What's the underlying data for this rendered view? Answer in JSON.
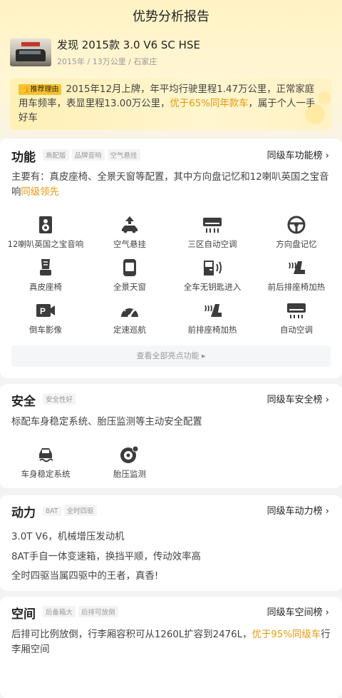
{
  "page": {
    "title": "优势分析报告"
  },
  "car": {
    "name": "发现 2015款 3.0 V6 SC HSE",
    "meta": "2015年 / 13万公里 / 石家庄"
  },
  "reason": {
    "tag": "推荐理由",
    "text_1": "2015年12月上牌，年平均行驶里程1.47万公里，正常家庭用车频率，表显里程13.00万公里，",
    "highlight": "优于65%同年款车",
    "text_2": "，属于个人一手好车"
  },
  "function": {
    "title": "功能",
    "chips": [
      "高配版",
      "品牌音响",
      "空气悬挂"
    ],
    "rank_link": "同级车功能榜 ›",
    "desc": "主要有：真皮座椅、全景天窗等配置，其中方向盘记忆和12喇叭英国之宝音响",
    "desc_highlight": "同级领先",
    "features": [
      {
        "label": "12喇叭英国之宝音响",
        "icon": "speaker-icon"
      },
      {
        "label": "空气悬挂",
        "icon": "air-suspension-icon"
      },
      {
        "label": "三区自动空调",
        "icon": "ac-unit-icon"
      },
      {
        "label": "方向盘记忆",
        "icon": "steering-wheel-icon"
      },
      {
        "label": "真皮座椅",
        "icon": "leather-seat-icon"
      },
      {
        "label": "全景天窗",
        "icon": "sunroof-icon"
      },
      {
        "label": "全车无钥匙进入",
        "icon": "keyless-door-icon"
      },
      {
        "label": "前后排座椅加热",
        "icon": "seat-heat-icon"
      },
      {
        "label": "倒车影像",
        "icon": "rear-camera-icon"
      },
      {
        "label": "定速巡航",
        "icon": "cruise-control-icon"
      },
      {
        "label": "前排座椅加热",
        "icon": "front-seat-heat-icon"
      },
      {
        "label": "自动空调",
        "icon": "auto-ac-icon"
      }
    ],
    "more_label": "查看全部亮点功能 ▸"
  },
  "safety": {
    "title": "安全",
    "chips": [
      "安全性好"
    ],
    "rank_link": "同级车安全榜 ›",
    "desc": "标配车身稳定系统、胎压监测等主动安全配置",
    "features": [
      {
        "label": "车身稳定系统",
        "icon": "stability-icon"
      },
      {
        "label": "胎压监测",
        "icon": "tire-pressure-icon"
      }
    ]
  },
  "power": {
    "title": "动力",
    "chips": [
      "8AT",
      "全时四驱"
    ],
    "rank_link": "同级车动力榜 ›",
    "lines": [
      "3.0T V6，机械增压发动机",
      "8AT手自一体变速箱，换挡平顺，传动效率高",
      "全时四驱当属四驱中的王者，真香!"
    ]
  },
  "space": {
    "title": "空间",
    "chips": [
      "后备箱大",
      "后排可放倒"
    ],
    "rank_link": "同级车空间榜 ›",
    "desc": "后排可比例放倒，行李厢容积可从1260L扩容到2476L，",
    "highlight": "优于95%同级车",
    "desc_tail": "行李厢空间"
  },
  "colors": {
    "accent": "#e59a0c",
    "tag": "#f4c233",
    "icon": "#3c3c3c"
  }
}
